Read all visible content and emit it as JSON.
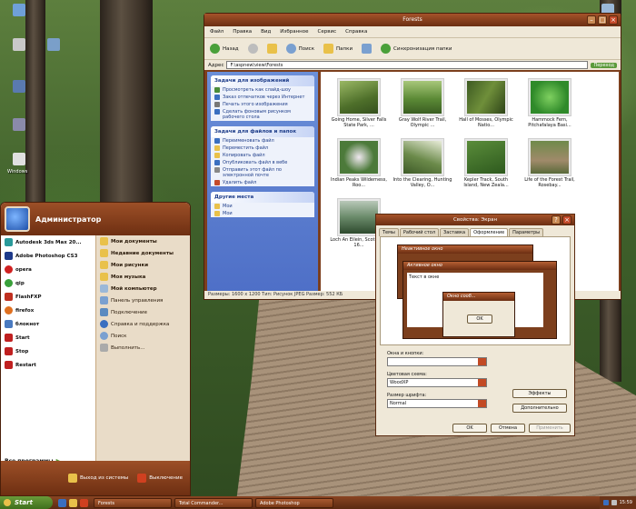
{
  "desktop": {
    "icons": [
      "Windows"
    ]
  },
  "explorer": {
    "title": "Forests",
    "menu": [
      "Файл",
      "Правка",
      "Вид",
      "Избранное",
      "Сервис",
      "Справка"
    ],
    "toolbar": {
      "back": "Назад",
      "search": "Поиск",
      "folders": "Папки",
      "sync": "Синхронизация папки"
    },
    "address_label": "Адрес",
    "address_value": "F:\\aspnew\\view\\Forests",
    "go_label": "Переход",
    "tasks_image": {
      "header": "Задачи для изображений",
      "items": [
        "Просмотреть как слайд-шоу",
        "Заказ отпечатков через Интернет",
        "Печать этого изображения",
        "Сделать фоновым рисунком рабочего стола"
      ]
    },
    "tasks_files": {
      "header": "Задачи для файлов и папок",
      "items": [
        "Переименовать файл",
        "Переместить файл",
        "Копировать файл",
        "Опубликовать файл в вебе",
        "Отправить этот файл по электронной почте",
        "Удалить файл"
      ]
    },
    "other_places": {
      "header": "Другие места",
      "items": [
        "Мои",
        "Мои"
      ]
    },
    "thumbnails": [
      "Going Home, Silver Falls State Park, ...",
      "Gray Wolf River Trail, Olympic ...",
      "Hall of Mosses, Olympic Natio...",
      "Hammock Fern, Pitchafalaya Basi...",
      "Indian Peaks Wilderness, Roo...",
      "Into the Clearing, Hunting Valley, O...",
      "Kepler Track, South Island, New Zeala...",
      "Life of the Forest Trail, Rosebay...",
      "Loch An Eilein, Scotland - 16..."
    ],
    "status": "Размеры: 1600 x 1200 Тип: Рисунок JPEG Размер: 552 КБ"
  },
  "dialog": {
    "title": "Свойства: Экран",
    "tabs": [
      "Темы",
      "Рабочий стол",
      "Заставка",
      "Оформление",
      "Параметры"
    ],
    "active_tab": "Оформление",
    "preview": {
      "inactive": "Неактивное окно",
      "active": "Активное окно",
      "msg": "Окно сооб...",
      "ok": "OK",
      "text": "Текст в окне"
    },
    "windows_buttons_label": "Окна и кнопки:",
    "windows_buttons_value": "",
    "color_scheme_label": "Цветовая схема:",
    "color_scheme_value": "WoodXP",
    "font_size_label": "Размер шрифта:",
    "font_size_value": "Normal",
    "effects_label": "Эффекты",
    "advanced_label": "Дополнительно",
    "ok_label": "OK",
    "cancel_label": "Отмена",
    "apply_label": "Применить"
  },
  "start_menu": {
    "user": "Администратор",
    "left_items": [
      "Autodesk 3ds Max 20...",
      "Adobe Photoshop CS3",
      "opera",
      "qip",
      "FlashFXP",
      "firefox",
      "блокнот",
      "Start",
      "Stop",
      "Restart"
    ],
    "right_items": [
      "Мои документы",
      "Недавние документы",
      "Мои рисунки",
      "Моя музыка",
      "Мой компьютер",
      "Панель управления",
      "Подключение",
      "Справка и поддержка",
      "Поиск",
      "Выполнить..."
    ],
    "all_programs": "Все программы",
    "logoff": "Выход из системы",
    "shutdown": "Выключение"
  },
  "taskbar": {
    "start": "Start",
    "tasks": [
      "Forests",
      "Total Commander...",
      "Adobe Photoshop"
    ],
    "clock": "15:59"
  },
  "colors": {
    "wood": "#7c3f1d",
    "title": "#a5532a",
    "taskpane": "#5b7fd2",
    "start_green": "#5a8c2e"
  }
}
